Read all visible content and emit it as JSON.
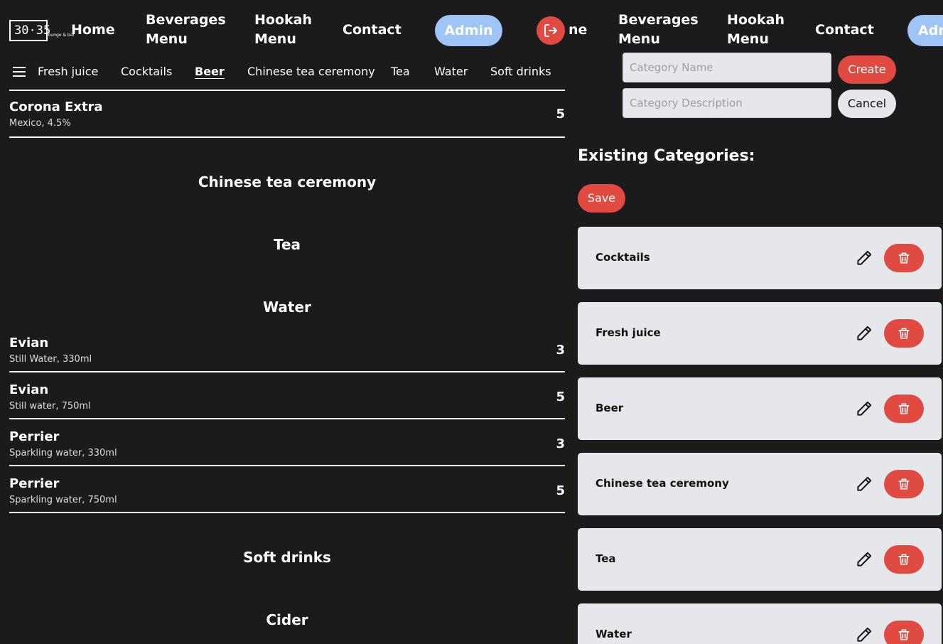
{
  "logo": {
    "text": "30·35",
    "subtext": "lounge & bar"
  },
  "nav": {
    "home": "Home",
    "beverages": "Beverages\nMenu",
    "hookah": "Hookah\nMenu",
    "contact": "Contact",
    "admin": "Admin"
  },
  "nav_right": {
    "home_partial": "ne",
    "beverages": "Beverages\nMenu",
    "hookah": "Hookah\nMenu",
    "contact": "Contact",
    "admin_partial": "Adr"
  },
  "category_nav": [
    "Fresh juice",
    "Cocktails",
    "Beer",
    "Chinese tea ceremony",
    "Tea",
    "Water",
    "Soft drinks"
  ],
  "menu": {
    "beer_item": {
      "name": "Corona Extra",
      "desc": "Mexico, 4.5%",
      "price": "5"
    },
    "sections": [
      "Chinese tea ceremony",
      "Tea",
      "Water",
      "Soft drinks",
      "Cider"
    ],
    "water_items": [
      {
        "name": "Evian",
        "desc": "Still Water, 330ml",
        "price": "3"
      },
      {
        "name": "Evian",
        "desc": "Still water, 750ml",
        "price": "5"
      },
      {
        "name": "Perrier",
        "desc": "Sparkling water, 330ml",
        "price": "3"
      },
      {
        "name": "Perrier",
        "desc": "Sparkling water, 750ml",
        "price": "5"
      }
    ]
  },
  "admin_form": {
    "name_placeholder": "Category Name",
    "desc_placeholder": "Category Description",
    "create": "Create",
    "cancel": "Cancel",
    "existing_title": "Existing Categories:",
    "save": "Save"
  },
  "categories": [
    "Cocktails",
    "Fresh juice",
    "Beer",
    "Chinese tea ceremony",
    "Tea",
    "Water"
  ],
  "colors": {
    "background": "#1b1b1b",
    "accent_red": "#e04a41",
    "admin_blue": "#9ec5f5",
    "card": "#e6e7eb"
  }
}
